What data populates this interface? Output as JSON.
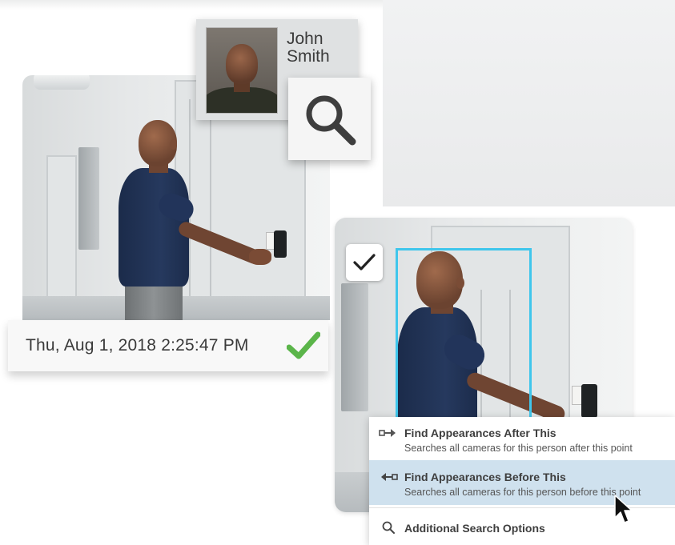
{
  "profile": {
    "first_name": "John",
    "last_name": "Smith"
  },
  "event": {
    "timestamp": "Thu, Aug 1, 2018 2:25:47 PM",
    "status_color": "#5bb54a"
  },
  "detection": {
    "box_color": "#3fc6ec"
  },
  "context_menu": {
    "items": [
      {
        "title": "Find Appearances After This",
        "subtitle": "Searches all cameras for this person after this point",
        "icon": "arrow-right-icon"
      },
      {
        "title": "Find Appearances Before This",
        "subtitle": "Searches all cameras for this person before this point",
        "icon": "arrow-left-icon"
      },
      {
        "title": "Additional Search Options",
        "icon": "search-icon"
      }
    ],
    "selected_index": 1,
    "selected_color": "#cfe1ee"
  }
}
